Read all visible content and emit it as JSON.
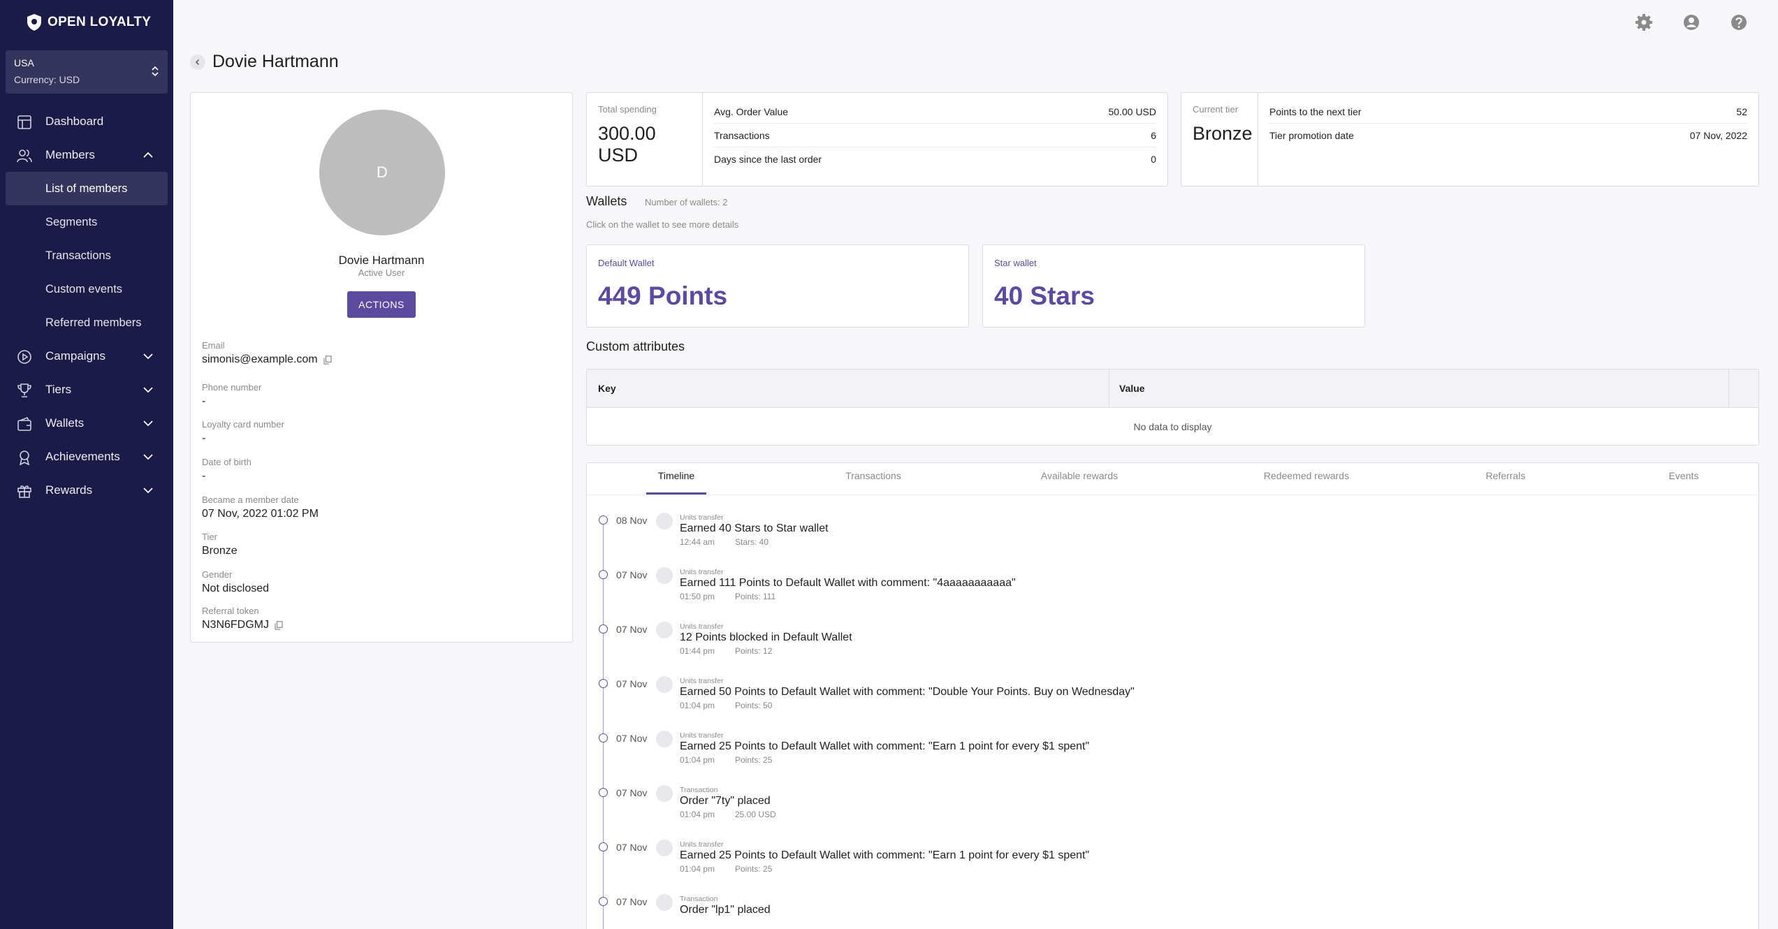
{
  "brand": {
    "name": "OPEN LOYALTY"
  },
  "region": {
    "name": "USA",
    "currency": "Currency: USD"
  },
  "nav": {
    "dashboard": "Dashboard",
    "members": "Members",
    "members_sub": [
      "List of members",
      "Segments",
      "Transactions",
      "Custom events",
      "Referred members"
    ],
    "campaigns": "Campaigns",
    "tiers": "Tiers",
    "wallets": "Wallets",
    "achievements": "Achievements",
    "rewards": "Rewards"
  },
  "page": {
    "title": "Dovie Hartmann"
  },
  "profile": {
    "avatar_letter": "D",
    "name": "Dovie Hartmann",
    "status": "Active User",
    "actions_label": "ACTIONS",
    "email_label": "Email",
    "email": "simonis@example.com",
    "phone_label": "Phone number",
    "phone": "-",
    "card_label": "Loyalty card number",
    "card": "-",
    "dob_label": "Date of birth",
    "dob": "-",
    "member_since_label": "Became a member date",
    "member_since": "07 Nov, 2022 01:02 PM",
    "tier_label": "Tier",
    "tier": "Bronze",
    "gender_label": "Gender",
    "gender": "Not disclosed",
    "referral_label": "Referral token",
    "referral": "N3N6FDGMJ"
  },
  "stats": {
    "total_spending_label": "Total spending",
    "total_spending": "300.00 USD",
    "rows": [
      {
        "label": "Avg. Order Value",
        "value": "50.00 USD"
      },
      {
        "label": "Transactions",
        "value": "6"
      },
      {
        "label": "Days since the last order",
        "value": "0"
      }
    ],
    "current_tier_label": "Current tier",
    "current_tier": "Bronze",
    "tier_rows": [
      {
        "label": "Points to the next tier",
        "value": "52"
      },
      {
        "label": "Tier promotion date",
        "value": "07 Nov, 2022"
      }
    ]
  },
  "wallets": {
    "title": "Wallets",
    "count": "Number of wallets: 2",
    "hint": "Click on the wallet to see more details",
    "items": [
      {
        "label": "Default Wallet",
        "value": "449 Points"
      },
      {
        "label": "Star wallet",
        "value": "40 Stars"
      }
    ]
  },
  "custom_attributes": {
    "title": "Custom attributes",
    "key_header": "Key",
    "value_header": "Value",
    "empty": "No data to display"
  },
  "tabs": [
    "Timeline",
    "Transactions",
    "Available rewards",
    "Redeemed rewards",
    "Referrals",
    "Events"
  ],
  "timeline": [
    {
      "date": "08 Nov",
      "type": "Units transfer",
      "title": "Earned 40 Stars to Star wallet",
      "time": "12:44 am",
      "meta": "Stars: 40"
    },
    {
      "date": "07 Nov",
      "type": "Units transfer",
      "title": "Earned 111 Points to Default Wallet with comment: \"4aaaaaaaaaaa\"",
      "time": "01:50 pm",
      "meta": "Points: 111"
    },
    {
      "date": "07 Nov",
      "type": "Units transfer",
      "title": "12 Points blocked in Default Wallet",
      "time": "01:44 pm",
      "meta": "Points: 12"
    },
    {
      "date": "07 Nov",
      "type": "Units transfer",
      "title": "Earned 50 Points to Default Wallet with comment: \"Double Your Points. Buy on Wednesday\"",
      "time": "01:04 pm",
      "meta": "Points: 50"
    },
    {
      "date": "07 Nov",
      "type": "Units transfer",
      "title": "Earned 25 Points to Default Wallet with comment: \"Earn 1 point for every $1 spent\"",
      "time": "01:04 pm",
      "meta": "Points: 25"
    },
    {
      "date": "07 Nov",
      "type": "Transaction",
      "title": "Order \"7ty\" placed",
      "time": "01:04 pm",
      "meta": "25.00 USD"
    },
    {
      "date": "07 Nov",
      "type": "Units transfer",
      "title": "Earned 25 Points to Default Wallet with comment: \"Earn 1 point for every $1 spent\"",
      "time": "01:04 pm",
      "meta": "Points: 25"
    },
    {
      "date": "07 Nov",
      "type": "Transaction",
      "title": "Order \"lp1\" placed",
      "time": "",
      "meta": ""
    }
  ]
}
